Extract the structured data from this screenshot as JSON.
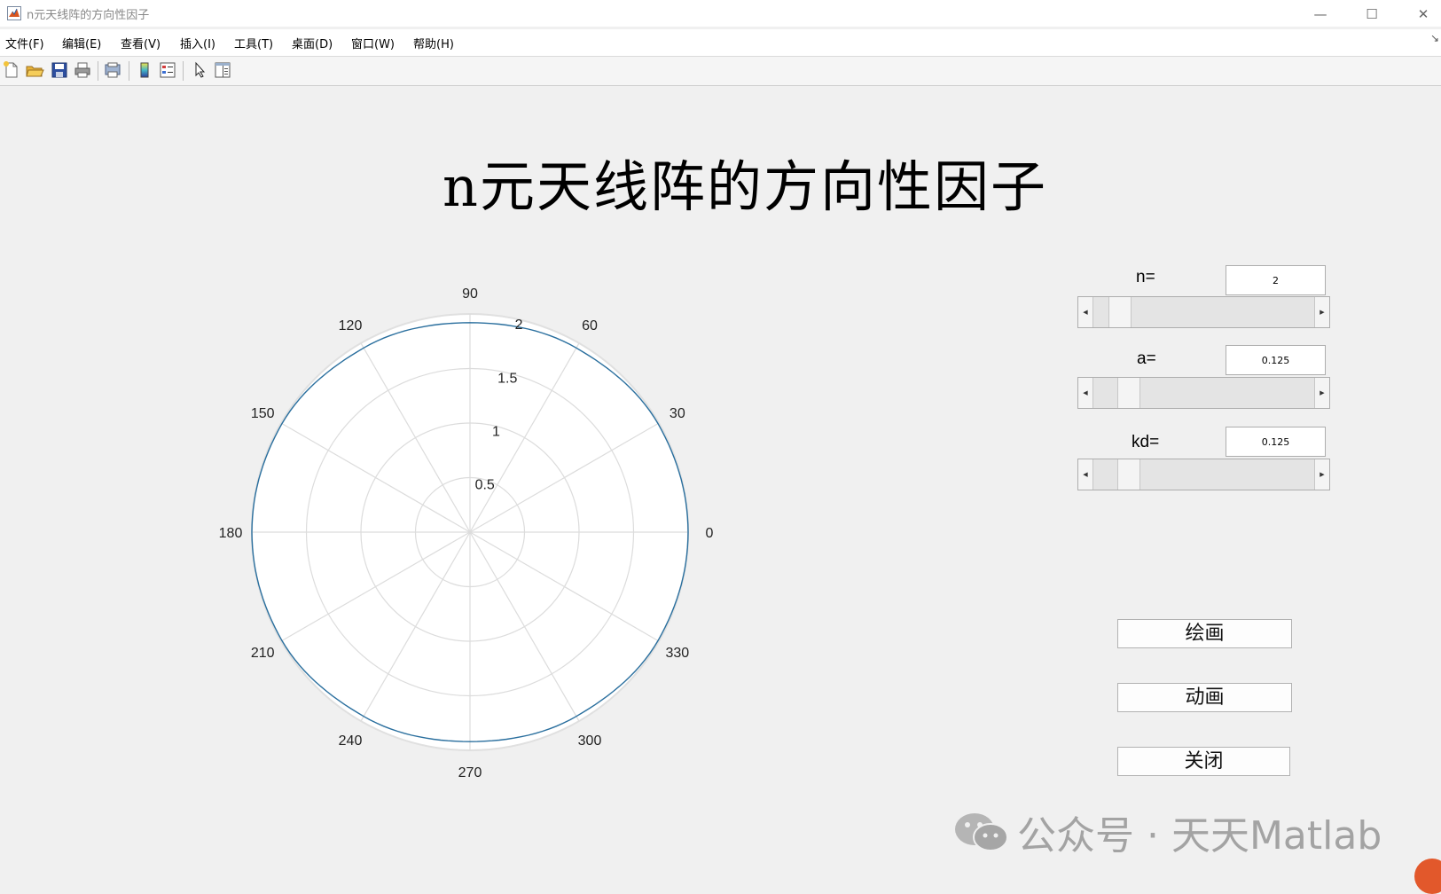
{
  "window": {
    "title": "n元天线阵的方向性因子",
    "minimize": "—",
    "maximize": "☐",
    "close": "✕"
  },
  "menu": {
    "items": [
      "文件(F)",
      "编辑(E)",
      "查看(V)",
      "插入(I)",
      "工具(T)",
      "桌面(D)",
      "窗口(W)",
      "帮助(H)"
    ],
    "edge_glyph": "↘"
  },
  "toolbar": {
    "buttons": [
      "new-file-icon",
      "open-folder-icon",
      "save-icon",
      "print-icon",
      "print-preview-icon",
      "colorbar-icon",
      "legend-icon",
      "pointer-icon",
      "property-editor-icon"
    ]
  },
  "heading": "n元天线阵的方向性因子",
  "chart_data": {
    "type": "polar",
    "angle_ticks": [
      "0",
      "30",
      "60",
      "90",
      "120",
      "150",
      "180",
      "210",
      "240",
      "270",
      "300",
      "330"
    ],
    "radial_ticks": [
      "0.5",
      "1",
      "1.5",
      "2"
    ],
    "rlim": [
      0,
      2
    ],
    "grid": true,
    "series": [
      {
        "color": "#2a6f9e",
        "theta_deg": [
          0,
          30,
          60,
          90,
          120,
          150,
          180,
          210,
          240,
          270,
          300,
          330,
          360
        ],
        "r": [
          2.0,
          1.99,
          1.95,
          1.92,
          1.95,
          1.99,
          2.0,
          1.99,
          1.95,
          1.92,
          1.95,
          1.99,
          2.0
        ]
      }
    ]
  },
  "controls": {
    "n": {
      "label": "n=",
      "value": "2",
      "slider_fraction": 0.08
    },
    "a": {
      "label": "a=",
      "value": "0.125",
      "slider_fraction": 0.125
    },
    "kd": {
      "label": "kd=",
      "value": "0.125",
      "slider_fraction": 0.125
    }
  },
  "buttons": {
    "draw": "绘画",
    "animate": "动画",
    "close": "关闭"
  },
  "watermark": "公众号 · 天天Matlab"
}
